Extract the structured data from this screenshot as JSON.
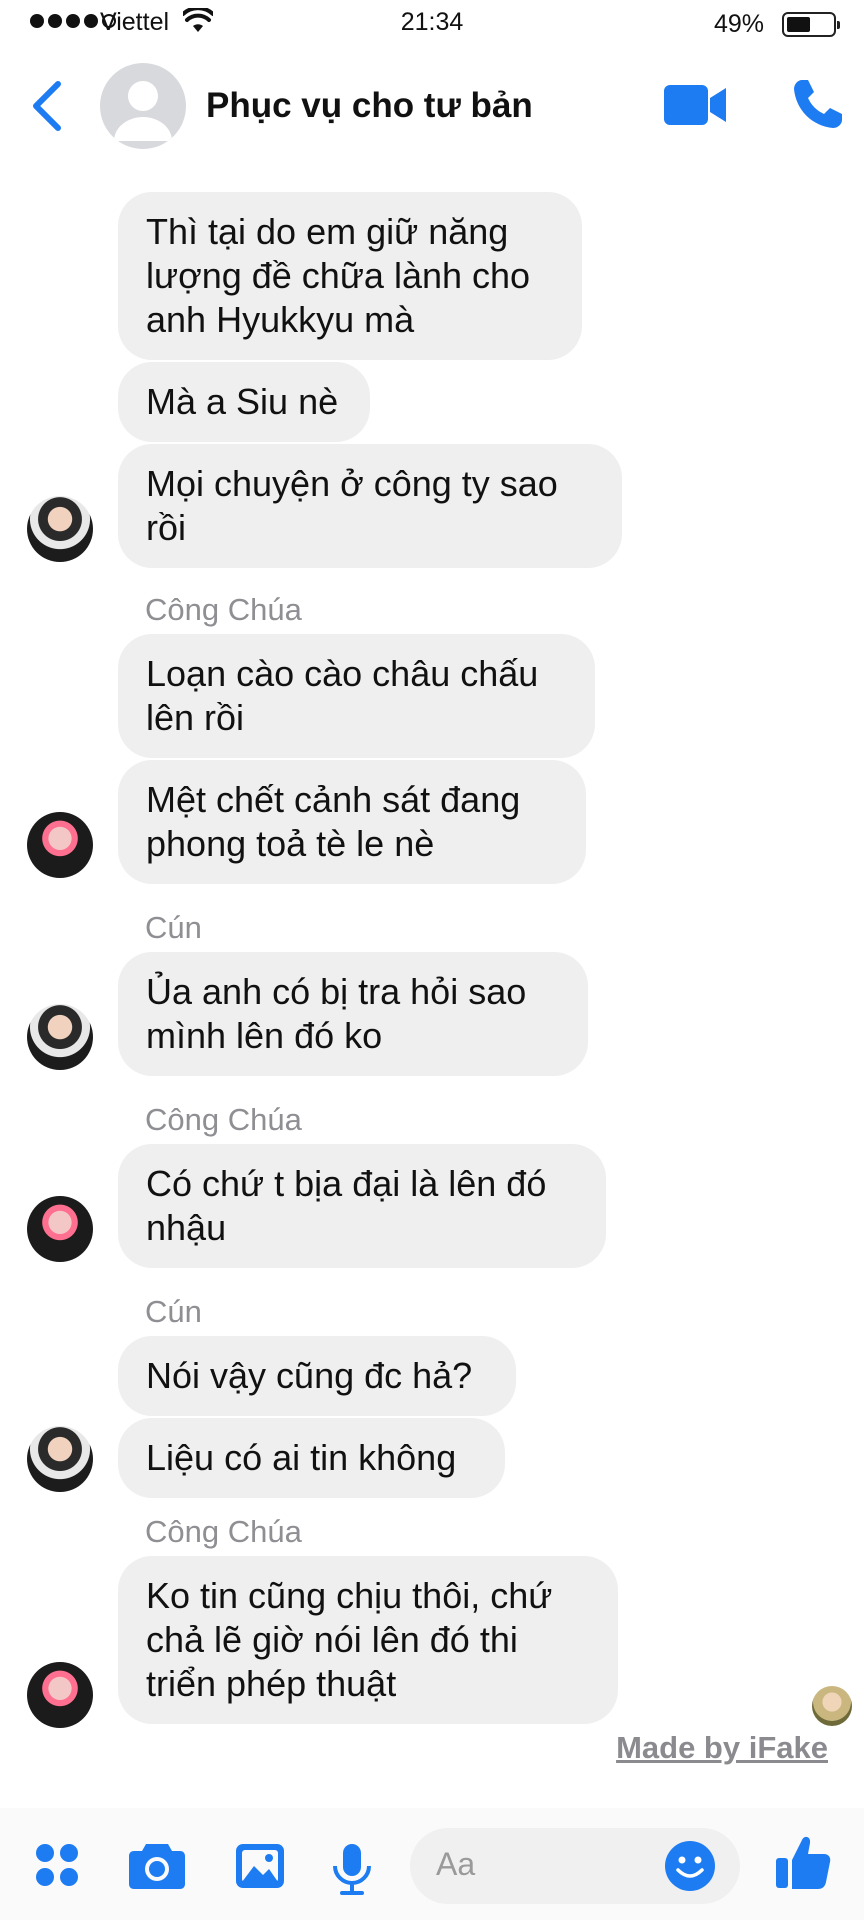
{
  "status_bar": {
    "carrier": "Viettel",
    "time": "21:34",
    "battery": "49%",
    "battery_level": 0.49
  },
  "header": {
    "title": "Phục vụ cho tư bản"
  },
  "colors": {
    "accent": "#1e7cf2",
    "bubble": "#efefef",
    "sender_name": "#8e8e93"
  },
  "messages": [
    {
      "text": "Thì tại do em giữ năng\nlượng đề chữa lành cho\nanh Hyukkyu mà"
    },
    {
      "text": "Mà a Siu nè"
    },
    {
      "text": "Mọi chuyện ở công ty sao\nrồi"
    },
    {
      "sender": "Công Chúa"
    },
    {
      "text": "Loạn cào cào châu chấu\nlên rồi"
    },
    {
      "text": "Mệt chết cảnh sát đang\nphong toả tè le nè"
    },
    {
      "sender": "Cún"
    },
    {
      "text": "Ủa anh có bị tra hỏi sao\nmình lên đó ko"
    },
    {
      "sender": "Công Chúa"
    },
    {
      "text": "Có chứ t bịa đại là lên đó\nnhậu"
    },
    {
      "sender": "Cún"
    },
    {
      "text": "Nói vậy cũng đc hả?"
    },
    {
      "text": "Liệu có ai tin không"
    },
    {
      "sender": "Công Chúa"
    },
    {
      "text": "Ko tin cũng chịu thôi, chứ\nchả lẽ giờ nói lên đó thi\ntriển phép thuật"
    }
  ],
  "watermark": "Made by iFake",
  "composer": {
    "placeholder": "Aa"
  },
  "icons": [
    "back-icon",
    "video-call-icon",
    "phone-icon",
    "apps-icon",
    "camera-icon",
    "gallery-icon",
    "microphone-icon",
    "emoji-icon",
    "like-icon"
  ]
}
